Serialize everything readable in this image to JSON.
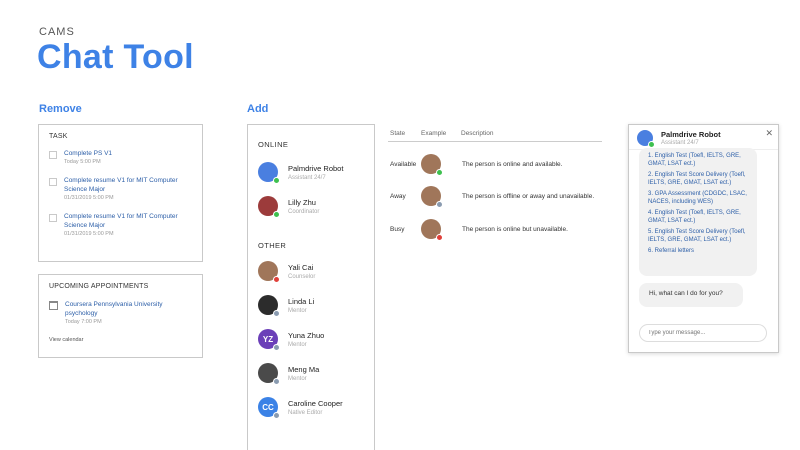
{
  "brand": "CAMS",
  "title": "Chat Tool",
  "sections": {
    "remove": "Remove",
    "add": "Add"
  },
  "tasks": {
    "header": "TASK",
    "items": [
      {
        "title": "Complete PS V1",
        "date": "Today 5:00 PM"
      },
      {
        "title": "Complete resume V1 for MIT Computer Science Major",
        "date": "01/31/2019 5:00 PM"
      },
      {
        "title": "Complete resume V1 for MIT Computer Science Major",
        "date": "01/31/2019 5:00 PM"
      }
    ]
  },
  "appointments": {
    "header": "UPCOMING APPOINTMENTS",
    "items": [
      {
        "title": "Coursera Pennsylvania University psychology",
        "date": "Today 7:00 PM"
      }
    ],
    "view_calendar": "View calendar"
  },
  "contacts": {
    "online_label": "ONLINE",
    "other_label": "OTHER",
    "online": [
      {
        "name": "Palmdrive Robot",
        "role": "Assistant 24/7",
        "avatar_color": "#4a7fe0",
        "status_color": "#3ec04f",
        "initials": ""
      },
      {
        "name": "Lilly Zhu",
        "role": "Coordinator",
        "avatar_color": "#9c3b3b",
        "status_color": "#3ec04f",
        "initials": ""
      }
    ],
    "other": [
      {
        "name": "Yali Cai",
        "role": "Counselor",
        "avatar_color": "#a0765a",
        "status_color": "#e0403a",
        "initials": ""
      },
      {
        "name": "Linda Li",
        "role": "Mentor",
        "avatar_color": "#2c2c2c",
        "status_color": "#8a9bb0",
        "initials": ""
      },
      {
        "name": "Yuna Zhuo",
        "role": "Mentor",
        "avatar_color": "#6b3fb8",
        "status_color": "#8a9bb0",
        "initials": "YZ"
      },
      {
        "name": "Meng Ma",
        "role": "Mentor",
        "avatar_color": "#4a4a4a",
        "status_color": "#8a9bb0",
        "initials": ""
      },
      {
        "name": "Caroline Cooper",
        "role": "Native Editor",
        "avatar_color": "#3b82e6",
        "status_color": "#8a9bb0",
        "initials": "CC"
      }
    ]
  },
  "legend": {
    "headers": {
      "state": "State",
      "example": "Example",
      "description": "Description"
    },
    "rows": [
      {
        "state": "Available",
        "description": "The person is online and available.",
        "status_color": "#3ec04f"
      },
      {
        "state": "Away",
        "description": "The person is offline or away and unavailable.",
        "status_color": "#8a9bb0"
      },
      {
        "state": "Busy",
        "description": "The person is online but unavailable.",
        "status_color": "#e0403a"
      }
    ],
    "avatar_color": "#a0765a"
  },
  "chat": {
    "name": "Palmdrive Robot",
    "subtitle": "Assistant 24/7",
    "options": [
      "1. English Test (Toefl, IELTS, GRE, GMAT, LSAT ect.)",
      "2. English Test Score Delivery (Toefl, IELTS, GRE, GMAT, LSAT ect.)",
      "3. GPA Assessment (CDGDC, LSAC, NACES, including WES)",
      "4. English Test (Toefl, IELTS, GRE, GMAT, LSAT ect.)",
      "5. English Test Score Delivery (Toefl, IELTS, GRE, GMAT, LSAT ect.)",
      "6. Referral letters"
    ],
    "greeting": "Hi, what can I do for you?",
    "input_placeholder": "Type your message...",
    "input_value": ""
  },
  "colors": {
    "accent": "#3e82e6",
    "link": "#2d5fa8"
  }
}
